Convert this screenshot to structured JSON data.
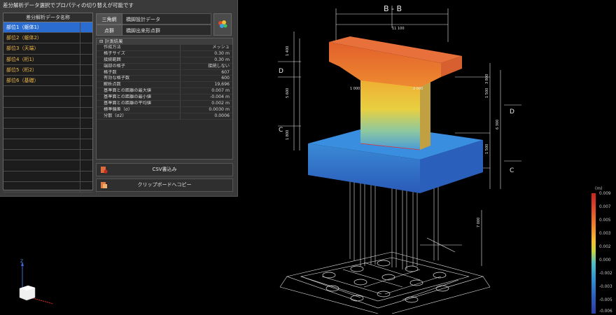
{
  "panel": {
    "title": "差分解析データ選択でプロパティの切り替えが可能です",
    "list_header": "差分解析データ名称",
    "items": [
      {
        "label": "部位1（躯体1）",
        "selected": true
      },
      {
        "label": "部位2（躯体2）",
        "selected": false
      },
      {
        "label": "部位3（天端）",
        "selected": false
      },
      {
        "label": "部位4（桁1）",
        "selected": false
      },
      {
        "label": "部位5（桁2）",
        "selected": false
      },
      {
        "label": "部位6（基礎）",
        "selected": false
      }
    ],
    "info": [
      {
        "key": "三角網",
        "value": "橋脚設計データ"
      },
      {
        "key": "点群",
        "value": "橋脚出来形点群"
      }
    ],
    "results_header": "計測結果",
    "results": [
      {
        "key": "作成方法",
        "value": "メッシュ"
      },
      {
        "key": "格子サイズ",
        "value": "0.30 m"
      },
      {
        "key": "接続範囲",
        "value": "0.30 m"
      },
      {
        "key": "端部の格子",
        "value": "接続しない"
      },
      {
        "key": "格子数",
        "value": "607"
      },
      {
        "key": "有効な格子数",
        "value": "600"
      },
      {
        "key": "解析点数",
        "value": "19,696"
      },
      {
        "key": "基準面との距離の最大値",
        "value": "0.007 m"
      },
      {
        "key": "基準面との距離の最小値",
        "value": "-0.004 m"
      },
      {
        "key": "基準面との距離の平均値",
        "value": "0.002 m"
      },
      {
        "key": "標準偏差（σ）",
        "value": "0.0030 m"
      },
      {
        "key": "分散（σ2）",
        "value": "0.0006"
      }
    ],
    "csv_button": "CSV書込み",
    "clipboard_button": "クリップボードへコピー"
  },
  "drawing": {
    "section_label": "B - B",
    "side_labels": [
      "D",
      "C",
      "D",
      "C"
    ],
    "dimension_texts": [
      "11 100",
      "1 000",
      "2 000",
      "1 400",
      "5 600",
      "1 800",
      "6 300",
      "3 800",
      "1 500",
      "1 500",
      "7 000"
    ],
    "axis_z": "Z"
  },
  "legend": {
    "unit": "(m)",
    "ticks": [
      "0.009",
      "0.007",
      "0.005",
      "0.003",
      "0.002",
      "0.000",
      "-0.002",
      "-0.003",
      "-0.005",
      "-0.006"
    ],
    "colors": {
      "max": "#c7241c",
      "mid": "#f5c02a",
      "min": "#2a3da8"
    }
  }
}
